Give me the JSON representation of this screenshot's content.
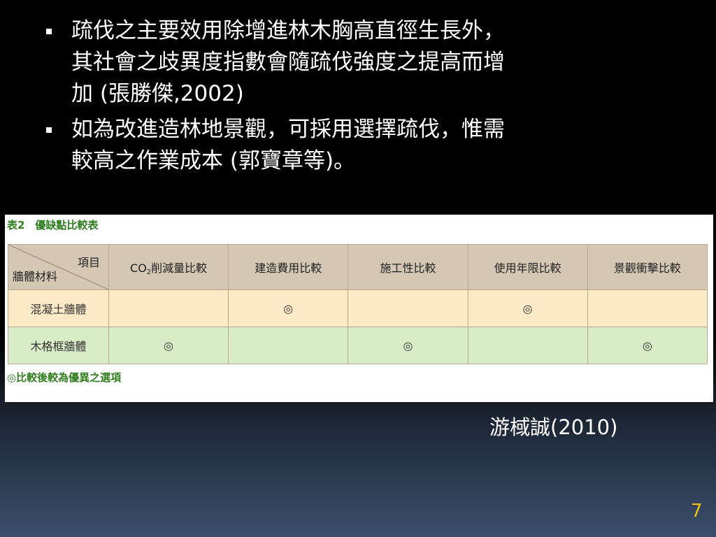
{
  "slide": {
    "bullets": [
      "疏伐之主要效用除增進林木胸高直徑生長外，\n其社會之歧異度指數會隨疏伐強度之提高而增\n加 (張勝傑,2002)",
      "如為改進造林地景觀，可採用選擇疏伐，惟需\n較高之作業成本 (郭寶章等)。"
    ],
    "citation": "游棫誠(2010)",
    "page_number": "7"
  },
  "table": {
    "caption": "表2　優缺點比較表",
    "corner_top": "項目",
    "corner_bottom": "牆體材料",
    "header_co2_prefix": "CO",
    "header_co2_sub": "2",
    "header_co2_suffix": "削減量比較",
    "headers": [
      "建造費用比較",
      "施工性比較",
      "使用年限比較",
      "景觀衝擊比較"
    ],
    "rows": [
      {
        "label": "混凝土牆體",
        "marks": [
          "",
          "◎",
          "",
          "◎",
          ""
        ]
      },
      {
        "label": "木格框牆體",
        "marks": [
          "◎",
          "",
          "◎",
          "",
          "◎"
        ]
      }
    ],
    "note": "◎比較後較為優異之選項"
  },
  "colors": {
    "accent_green": "#2f7d1f",
    "header_bg": "#d4c8b5",
    "row_concrete_bg": "#fdebc8",
    "row_wood_bg": "#d9ecc8",
    "page_number": "#f2c21b"
  }
}
